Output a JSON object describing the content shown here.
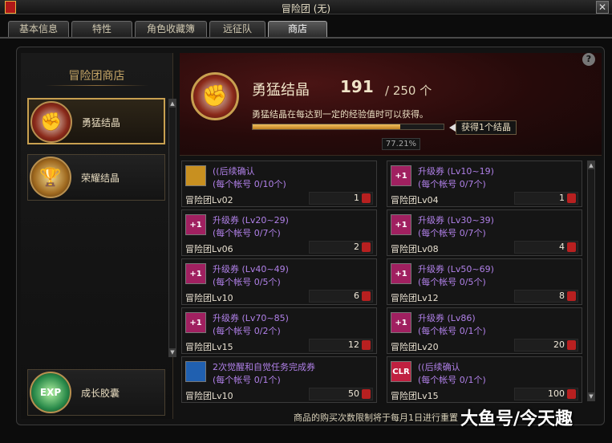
{
  "window": {
    "title": "冒险团 (无)",
    "close_label": "✕"
  },
  "tabs": [
    {
      "label": "基本信息",
      "active": false
    },
    {
      "label": "特性",
      "active": false
    },
    {
      "label": "角色收藏簿",
      "active": false
    },
    {
      "label": "远征队",
      "active": false
    },
    {
      "label": "商店",
      "active": true
    }
  ],
  "sidebar": {
    "title": "冒险团商店",
    "categories": [
      {
        "label": "勇猛结晶",
        "icon": "fist-icon",
        "active": true
      },
      {
        "label": "荣耀结晶",
        "icon": "trophy-icon",
        "active": false
      },
      {
        "label": "成长胶囊",
        "icon": "exp-capsule-icon",
        "active": false
      }
    ]
  },
  "header": {
    "name": "勇猛结晶",
    "count": "191",
    "max": "/ 250 个",
    "description": "勇猛结晶在每达到一定的经验值时可以获得。",
    "progress_fraction": 0.7721,
    "progress_label": "77.21%",
    "tip": "获得1个结晶",
    "help_label": "?"
  },
  "items": [
    {
      "name": "((后续确认",
      "limit": "(每个帐号 0/10个)",
      "req": "冒险团Lv02",
      "price": "1",
      "icon": "potion-icon",
      "icon_color": "#c89020"
    },
    {
      "name": "升级券 (Lv10~19)",
      "limit": "(每个帐号 0/7个)",
      "req": "冒险团Lv04",
      "price": "1",
      "icon": "level-ticket-icon",
      "icon_color": "#a02060"
    },
    {
      "name": "升级券 (Lv20~29)",
      "limit": "(每个帐号 0/7个)",
      "req": "冒险团Lv06",
      "price": "2",
      "icon": "level-ticket-icon",
      "icon_color": "#a02060"
    },
    {
      "name": "升级券 (Lv30~39)",
      "limit": "(每个帐号 0/7个)",
      "req": "冒险团Lv08",
      "price": "4",
      "icon": "level-ticket-icon",
      "icon_color": "#a02060"
    },
    {
      "name": "升级券 (Lv40~49)",
      "limit": "(每个帐号 0/5个)",
      "req": "冒险团Lv10",
      "price": "6",
      "icon": "level-ticket-icon",
      "icon_color": "#a02060"
    },
    {
      "name": "升级券 (Lv50~69)",
      "limit": "(每个帐号 0/5个)",
      "req": "冒险团Lv12",
      "price": "8",
      "icon": "level-ticket-icon",
      "icon_color": "#a02060"
    },
    {
      "name": "升级券 (Lv70~85)",
      "limit": "(每个帐号 0/2个)",
      "req": "冒险团Lv15",
      "price": "12",
      "icon": "level-ticket-icon",
      "icon_color": "#a02060"
    },
    {
      "name": "升级券 (Lv86)",
      "limit": "(每个帐号 0/1个)",
      "req": "冒险团Lv20",
      "price": "20",
      "icon": "level-ticket-icon",
      "icon_color": "#a02060"
    },
    {
      "name": "2次觉醒和自觉任务完成券",
      "limit": "(每个帐号 0/1个)",
      "req": "冒险团Lv10",
      "price": "50",
      "icon": "quest-ticket-icon",
      "icon_color": "#2060b0"
    },
    {
      "name": "((后续确认",
      "limit": "(每个帐号 0/1个)",
      "req": "冒险团Lv15",
      "price": "100",
      "icon": "clear-ticket-icon",
      "icon_color": "#c02040"
    }
  ],
  "footer_note": "商品的购买次数限制将于每月1日进行重置",
  "watermark": "大鱼号/今天趣",
  "icon_glyphs": {
    "level": "+1",
    "clear": "CLR"
  }
}
